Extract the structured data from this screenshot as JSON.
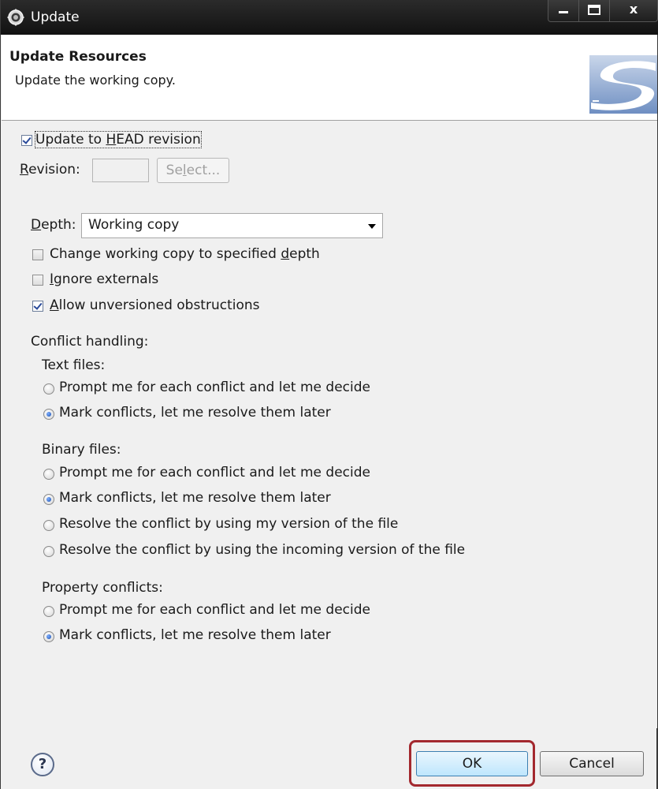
{
  "window": {
    "title": "Update",
    "controls": {
      "minimize": "minimize",
      "maximize": "maximize",
      "close": "x"
    }
  },
  "banner": {
    "heading": "Update Resources",
    "description": "Update the working copy."
  },
  "update_to_head": {
    "label_before": "Update to ",
    "mnemonic": "H",
    "label_after": "EAD revision",
    "checked": true
  },
  "revision": {
    "mnemonic": "R",
    "label_rest": "evision:",
    "value": "",
    "select_button_pre": "Se",
    "select_button_mn": "l",
    "select_button_post": "ect..."
  },
  "depth": {
    "mnemonic": "D",
    "label_rest": "epth:",
    "selected": "Working copy"
  },
  "options": {
    "change_depth": {
      "label_pre": "Change working copy to specified ",
      "mnemonic": "d",
      "label_post": "epth",
      "checked": false
    },
    "ignore_externals": {
      "mnemonic": "I",
      "label_post": "gnore externals",
      "checked": false
    },
    "allow_unversioned": {
      "mnemonic": "A",
      "label_post": "llow unversioned obstructions",
      "checked": true
    }
  },
  "conflict_handling": {
    "title": "Conflict handling:",
    "text_files": {
      "label": "Text files:",
      "options": [
        "Prompt me for each conflict and let me decide",
        "Mark conflicts, let me resolve them later"
      ],
      "selected_index": 1
    },
    "binary_files": {
      "label": "Binary files:",
      "options": [
        "Prompt me for each conflict and let me decide",
        "Mark conflicts, let me resolve them later",
        "Resolve the conflict by using my version of the file",
        "Resolve the conflict by using the incoming version of the file"
      ],
      "selected_index": 1
    },
    "property_conflicts": {
      "label": "Property conflicts:",
      "options": [
        "Prompt me for each conflict and let me decide",
        "Mark conflicts, let me resolve them later"
      ],
      "selected_index": 1
    }
  },
  "footer": {
    "help": "?",
    "ok": "OK",
    "cancel": "Cancel"
  },
  "colors": {
    "titlebar": "#1c1c1c",
    "highlight": "#a3282e",
    "dialog_bg": "#f0f0f0"
  }
}
